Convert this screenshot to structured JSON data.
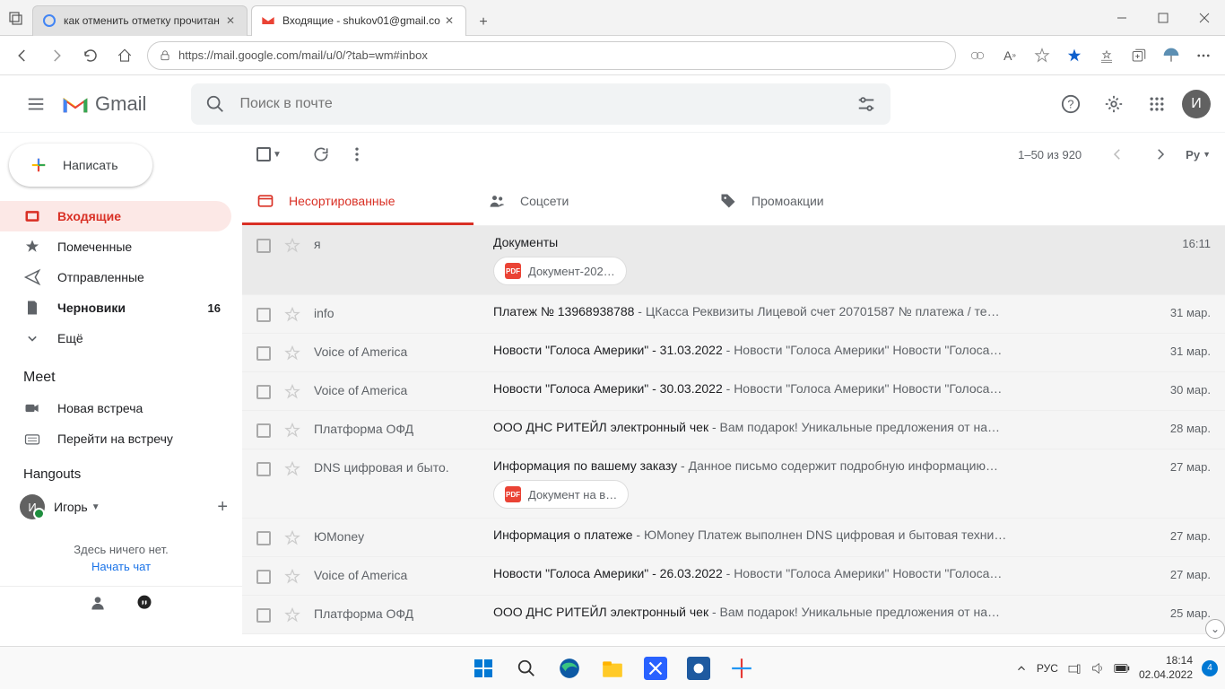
{
  "browser": {
    "tabs": [
      {
        "title": "как отменить отметку прочитан",
        "favicon": "google"
      },
      {
        "title": "Входящие - shukov01@gmail.co",
        "favicon": "gmail"
      }
    ],
    "url": "https://mail.google.com/mail/u/0/?tab=wm#inbox"
  },
  "gmail": {
    "brand": "Gmail",
    "search_placeholder": "Поиск в почте",
    "avatar_letter": "И"
  },
  "compose": "Написать",
  "nav": {
    "inbox": "Входящие",
    "starred": "Помеченные",
    "sent": "Отправленные",
    "drafts": "Черновики",
    "drafts_count": "16",
    "more": "Ещё"
  },
  "meet": {
    "header": "Meet",
    "new": "Новая встреча",
    "join": "Перейти на встречу"
  },
  "hangouts": {
    "header": "Hangouts",
    "user": "Игорь",
    "avatar_letter": "И",
    "empty": "Здесь ничего нет.",
    "start": "Начать чат"
  },
  "toolbar": {
    "count": "1–50 из 920",
    "lang": "Ру"
  },
  "categories": {
    "primary": "Несортированные",
    "social": "Соцсети",
    "promo": "Промоакции"
  },
  "emails": [
    {
      "sender": "я",
      "subject": "Документы",
      "snippet": "",
      "date": "16:11",
      "attachment": "Документ-202…"
    },
    {
      "sender": "info",
      "subject": "Платеж № 13968938788",
      "snippet": " - ЦКасса Реквизиты Лицевой счет 20701587 № платежа / те…",
      "date": "31 мар."
    },
    {
      "sender": "Voice of America",
      "subject": "Новости \"Голоса Америки\" - 31.03.2022",
      "snippet": " - Новости \"Голоса Америки\" Новости \"Голоса…",
      "date": "31 мар."
    },
    {
      "sender": "Voice of America",
      "subject": "Новости \"Голоса Америки\" - 30.03.2022",
      "snippet": " - Новости \"Голоса Америки\" Новости \"Голоса…",
      "date": "30 мар."
    },
    {
      "sender": "Платформа ОФД",
      "subject": "ООО ДНС РИТЕЙЛ электронный чек",
      "snippet": " - Вам подарок! Уникальные предложения от на…",
      "date": "28 мар."
    },
    {
      "sender": "DNS цифровая и быто.",
      "subject": "Информация по вашему заказу",
      "snippet": " - Данное письмо содержит подробную информацию…",
      "date": "27 мар.",
      "attachment": "Документ на в…"
    },
    {
      "sender": "ЮMoney",
      "subject": "Информация о платеже",
      "snippet": " - ЮMoney Платеж выполнен DNS цифровая и бытовая техни…",
      "date": "27 мар."
    },
    {
      "sender": "Voice of America",
      "subject": "Новости \"Голоса Америки\" - 26.03.2022",
      "snippet": " - Новости \"Голоса Америки\" Новости \"Голоса…",
      "date": "27 мар."
    },
    {
      "sender": "Платформа ОФД",
      "subject": "ООО ДНС РИТЕЙЛ электронный чек",
      "snippet": " - Вам подарок! Уникальные предложения от на…",
      "date": "25 мар."
    }
  ],
  "taskbar": {
    "lang": "РУС",
    "time": "18:14",
    "date": "02.04.2022",
    "notif": "4"
  }
}
